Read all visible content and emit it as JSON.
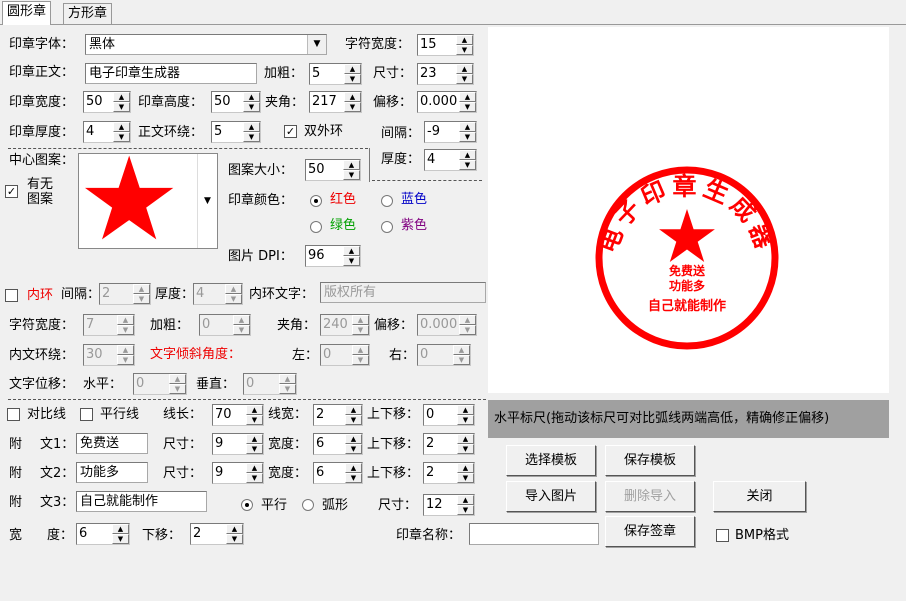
{
  "tabs": [
    "圆形章",
    "方形章"
  ],
  "row1": {
    "font_label": "印章字体：",
    "font_value": "黑体",
    "char_width_label": "字符宽度：",
    "char_width_value": "15"
  },
  "row2": {
    "text_label": "印章正文：",
    "text_value": "电子印章生成器",
    "bold_label": "加粗：",
    "bold_value": "5",
    "size_label": "尺寸：",
    "size_value": "23"
  },
  "row3": {
    "width_label": "印章宽度：",
    "width_value": "50",
    "height_label": "印章高度：",
    "height_value": "50",
    "angle_label": "夹角：",
    "angle_value": "217",
    "offset_label": "偏移：",
    "offset_value": "0.000"
  },
  "row4": {
    "thickness_label": "印章厚度：",
    "thickness_value": "4",
    "ring_label": "正文环绕：",
    "ring_value": "5",
    "double_ring_label": "双外环",
    "double_ring_checked": true,
    "gap_label": "间隔：",
    "gap_value": "-9",
    "thick2_label": "厚度：",
    "thick2_value": "4"
  },
  "center": {
    "pattern_label": "中心图案：",
    "has_label_1": "有无",
    "has_label_2": "图案",
    "has_checked": true,
    "pattern_size_label": "图案大小：",
    "pattern_size_value": "50",
    "color_label": "印章颜色：",
    "colors": [
      "红色",
      "蓝色",
      "绿色",
      "紫色"
    ],
    "selected_color": "红色",
    "dpi_label": "图片 DPI：",
    "dpi_value": "96"
  },
  "inner": {
    "ring_label": "内环",
    "ring_checked": false,
    "gap_label": "间隔：",
    "gap_value": "2",
    "thick_label": "厚度：",
    "thick_value": "4",
    "text_label": "内环文字：",
    "text_value": "版权所有",
    "char_width_label": "字符宽度：",
    "char_width_value": "7",
    "bold_label": "加粗：",
    "bold_value": "0",
    "angle_label": "夹角：",
    "angle_value": "240",
    "offset_label": "偏移：",
    "offset_value": "0.000",
    "ring2_label": "内文环绕：",
    "ring2_value": "30",
    "tilt_label": "文字倾斜角度：",
    "left_label": "左：",
    "left_value": "0",
    "right_label": "右：",
    "right_value": "0",
    "shift_label": "文字位移：",
    "horiz_label": "水平：",
    "horiz_value": "0",
    "vert_label": "垂直：",
    "vert_value": "0"
  },
  "lines": {
    "contrast_label": "对比线",
    "contrast_checked": false,
    "parallel_label": "平行线",
    "parallel_checked": false,
    "length_label": "线长：",
    "length_value": "70",
    "width_label": "线宽：",
    "width_value": "2",
    "move_label": "上下移：",
    "move_value": "0"
  },
  "attach1": {
    "label_a": "附",
    "label_b": "文1：",
    "text": "免费送",
    "size_label": "尺寸：",
    "size_value": "9",
    "width_label": "宽度：",
    "width_value": "6",
    "move_label": "上下移：",
    "move_value": "2"
  },
  "attach2": {
    "label_a": "附",
    "label_b": "文2：",
    "text": "功能多",
    "size_label": "尺寸：",
    "size_value": "9",
    "width_label": "宽度：",
    "width_value": "6",
    "move_label": "上下移：",
    "move_value": "2"
  },
  "attach3": {
    "label_a": "附",
    "label_b": "文3：",
    "text": "自己就能制作",
    "parallel_label": "平行",
    "arc_label": "弧形",
    "mode": "平行",
    "size_label": "尺寸：",
    "size_value": "12"
  },
  "bottom": {
    "width_label_a": "宽",
    "width_label_b": "度：",
    "width_value": "6",
    "down_label": "下移：",
    "down_value": "2",
    "name_label": "印章名称：",
    "name_value": "",
    "bmp_label": "BMP格式",
    "bmp_checked": false
  },
  "buttons": {
    "select_template": "选择模板",
    "save_template": "保存模板",
    "import_image": "导入图片",
    "delete_import": "删除导入",
    "close": "关闭",
    "save_seal": "保存签章"
  },
  "ruler_text": "水平标尺(拖动该标尺可对比弧线两端高低，精确修正偏移)",
  "seal": {
    "main_text": "电子印章生成器",
    "line1": "免费送",
    "line2": "功能多",
    "line3": "自己就能制作",
    "color": "#ff0000"
  },
  "icons": {
    "star": "star-icon",
    "dropdown": "chevron-down-icon",
    "spin_up": "arrow-up-icon",
    "spin_down": "arrow-down-icon"
  }
}
